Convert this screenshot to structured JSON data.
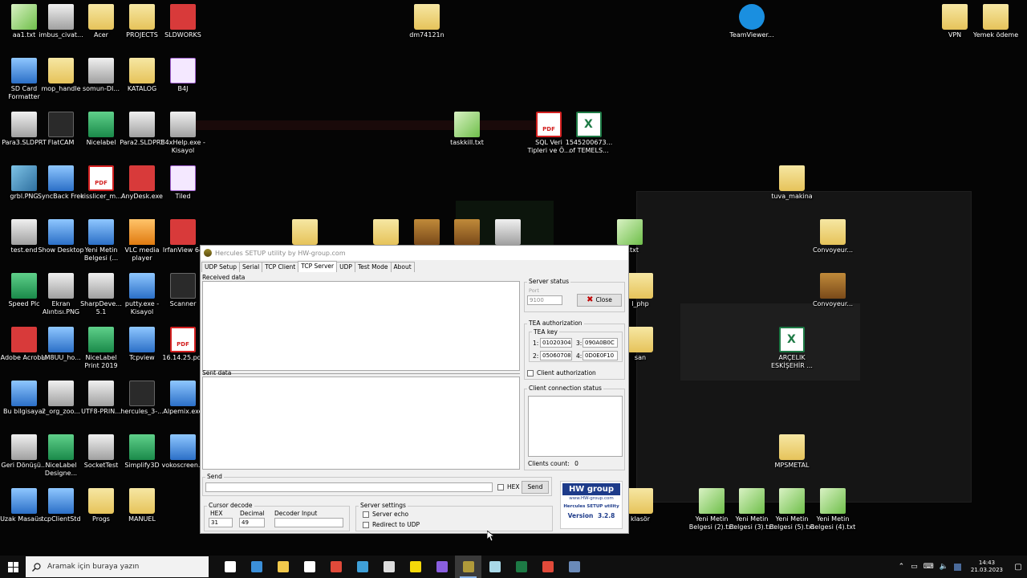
{
  "desktop_icons": [
    {
      "label": "aa1.txt",
      "type": "txt"
    },
    {
      "label": "imbus_civat...",
      "type": "grey"
    },
    {
      "label": "Acer",
      "type": "folder"
    },
    {
      "label": "PROJECTS",
      "type": "folder"
    },
    {
      "label": "SLDWORKS",
      "type": "red"
    },
    {
      "label": "dm74121n",
      "type": "folder"
    },
    {
      "label": "TeamViewer...",
      "type": "teal"
    },
    {
      "label": "VPN",
      "type": "folder"
    },
    {
      "label": "Yemek ödeme",
      "type": "folder"
    },
    {
      "label": "SD Card Formatter",
      "type": "blue"
    },
    {
      "label": "mop_handle",
      "type": "folder"
    },
    {
      "label": "somun-DI...",
      "type": "grey"
    },
    {
      "label": "KATALOG",
      "type": "folder"
    },
    {
      "label": "B4J",
      "type": "purple"
    },
    {
      "label": "Para3.SLDPRT",
      "type": "grey"
    },
    {
      "label": "FlatCAM",
      "type": "dark"
    },
    {
      "label": "Nicelabel",
      "type": "green"
    },
    {
      "label": "Para2.SLDPRT",
      "type": "grey"
    },
    {
      "label": "B4xHelp.exe - Kisayol",
      "type": "grey"
    },
    {
      "label": "taskkill.txt",
      "type": "txt"
    },
    {
      "label": "SQL Veri Tipleri ve Ö...",
      "type": "pdf"
    },
    {
      "label": "1545200673... of TEMELS...",
      "type": "xls"
    },
    {
      "label": "grbl.PNG",
      "type": "img"
    },
    {
      "label": "SyncBack Free",
      "type": "blue"
    },
    {
      "label": "kisslicer_m...",
      "type": "pdf"
    },
    {
      "label": "AnyDesk.exe",
      "type": "red"
    },
    {
      "label": "Tiled",
      "type": "purple"
    },
    {
      "label": "tuva_makina",
      "type": "folder"
    },
    {
      "label": "test.end",
      "type": "grey"
    },
    {
      "label": "Show Desktop",
      "type": "blue"
    },
    {
      "label": "Yeni Metin Belgesi (...",
      "type": "blue"
    },
    {
      "label": "VLC media player",
      "type": "orange"
    },
    {
      "label": "IrfanView 64",
      "type": "red"
    },
    {
      "label": "Convoyeur...",
      "type": "folder"
    },
    {
      "label": "Speed Plc",
      "type": "green"
    },
    {
      "label": "Ekran Alıntısı.PNG",
      "type": "grey"
    },
    {
      "label": "SharpDeve... 5.1",
      "type": "grey"
    },
    {
      "label": "putty.exe - Kisayol",
      "type": "blue"
    },
    {
      "label": "Scanner",
      "type": "dark"
    },
    {
      "label": "Convoyeur...",
      "type": "box"
    },
    {
      "label": "Adobe Acrobat",
      "type": "red"
    },
    {
      "label": "LM8UU_ho...",
      "type": "blue"
    },
    {
      "label": "NiceLabel Print 2019",
      "type": "green"
    },
    {
      "label": "Tcpview",
      "type": "blue"
    },
    {
      "label": "16.14.25.pdf",
      "type": "pdf"
    },
    {
      "label": "ARÇELIK ESKİŞEHİR ...",
      "type": "xls"
    },
    {
      "label": "Bu bilgisayar",
      "type": "blue"
    },
    {
      "label": "2_org_zoo...",
      "type": "grey"
    },
    {
      "label": "UTF8-PRIN...",
      "type": "grey"
    },
    {
      "label": "hercules_3-...",
      "type": "dark"
    },
    {
      "label": "Alpemix.exe",
      "type": "blue"
    },
    {
      "label": "Geri Dönüşü...",
      "type": "grey"
    },
    {
      "label": "NiceLabel Designe...",
      "type": "green"
    },
    {
      "label": "SocketTest",
      "type": "grey"
    },
    {
      "label": "Simplify3D",
      "type": "green"
    },
    {
      "label": "vokoscreen...",
      "type": "blue"
    },
    {
      "label": "MPSMETAL",
      "type": "folder"
    },
    {
      "label": "Uzak Masaüs...",
      "type": "blue"
    },
    {
      "label": "tcpClientStd",
      "type": "blue"
    },
    {
      "label": "Progs",
      "type": "folder"
    },
    {
      "label": "MANUEL",
      "type": "folder"
    },
    {
      "label": "Yeni Metin Belgesi (2).txt",
      "type": "txt"
    },
    {
      "label": "Yeni Metin Belgesi (3).txt",
      "type": "txt"
    },
    {
      "label": "Yeni Metin Belgesi (5).txt",
      "type": "txt"
    },
    {
      "label": "Yeni Metin Belgesi (4).txt",
      "type": "txt"
    },
    {
      "label": "",
      "type": "folder"
    },
    {
      "label": "",
      "type": "folder"
    },
    {
      "label": "",
      "type": "box"
    },
    {
      "label": "",
      "type": "box"
    },
    {
      "label": "",
      "type": "grey"
    },
    {
      "label": "ey.txt",
      "type": "txt"
    },
    {
      "label": "l_php",
      "type": "folder"
    },
    {
      "label": "san",
      "type": "folder"
    },
    {
      "label": "klasör",
      "type": "folder"
    }
  ],
  "hercules": {
    "title": "Hercules SETUP utility by HW-group.com",
    "tabs": [
      "UDP Setup",
      "Serial",
      "TCP Client",
      "TCP Server",
      "UDP",
      "Test Mode",
      "About"
    ],
    "active_tab": "TCP Server",
    "received_label": "Received data",
    "sent_label": "Sent data",
    "server_status": {
      "label": "Server status",
      "port_label": "Port",
      "port_value": "9100",
      "close_button": "Close"
    },
    "tea": {
      "label": "TEA authorization",
      "key_label": "TEA key",
      "k1_label": "1:",
      "k1": "01020304",
      "k2_label": "2:",
      "k2": "05060708",
      "k3_label": "3:",
      "k3": "090A0B0C",
      "k4_label": "4:",
      "k4": "0D0E0F10",
      "client_auth": "Client authorization"
    },
    "client_conn": {
      "label": "Client connection status",
      "count_label": "Clients count:",
      "count_value": "0"
    },
    "send": {
      "label": "Send",
      "hex_label": "HEX",
      "send_button": "Send"
    },
    "cursor_decode": {
      "label": "Cursor decode",
      "hex_label": "HEX",
      "hex_value": "31",
      "decimal_label": "Decimal",
      "decimal_value": "49",
      "decoder_label": "Decoder Input",
      "decoder_value": ""
    },
    "server_settings": {
      "label": "Server settings",
      "echo": "Server echo",
      "redirect": "Redirect to UDP"
    },
    "logo": {
      "brand": "HW group",
      "url": "www.HW-group.com",
      "product": "Hercules SETUP utility",
      "version_label": "Version",
      "version": "3.2.8"
    }
  },
  "taskbar": {
    "search_placeholder": "Aramak için buraya yazın",
    "time": "14:43",
    "date": "21.03.2023",
    "apps": [
      {
        "name": "task-view",
        "color": "#ffffff"
      },
      {
        "name": "edge",
        "color": "#3b8fd9"
      },
      {
        "name": "file-explorer",
        "color": "#f2c94c"
      },
      {
        "name": "store",
        "color": "#ffffff"
      },
      {
        "name": "chrome",
        "color": "#e04a3a"
      },
      {
        "name": "app-blue",
        "color": "#3fa0d8"
      },
      {
        "name": "app-eagle",
        "color": "#dddddd"
      },
      {
        "name": "sticky-notes",
        "color": "#f5d90a"
      },
      {
        "name": "maps",
        "color": "#8a5fe0"
      },
      {
        "name": "hercules",
        "color": "#b09a3a"
      },
      {
        "name": "app-drum",
        "color": "#a8d8e8"
      },
      {
        "name": "excel",
        "color": "#1d7a45"
      },
      {
        "name": "chrome-2",
        "color": "#e04a3a"
      },
      {
        "name": "app-window",
        "color": "#6a8ab8"
      }
    ]
  }
}
